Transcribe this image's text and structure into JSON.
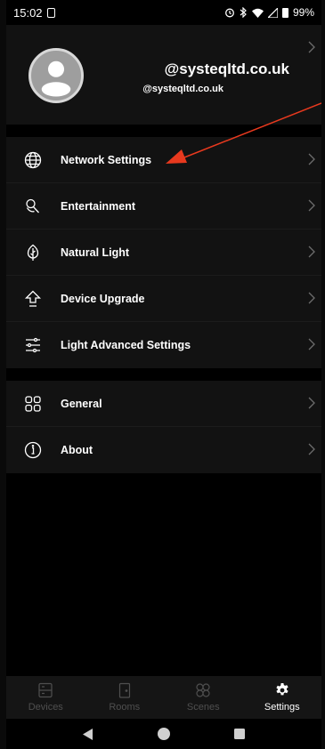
{
  "status": {
    "time": "15:02",
    "battery": "99%"
  },
  "profile": {
    "name": "@systeqltd.co.uk",
    "email": "@systeqltd.co.uk"
  },
  "menu_group_1": [
    {
      "label": "Network Settings",
      "icon": "globe-icon"
    },
    {
      "label": "Entertainment",
      "icon": "microphone-icon"
    },
    {
      "label": "Natural Light",
      "icon": "leaf-icon"
    },
    {
      "label": "Device Upgrade",
      "icon": "upgrade-arrow-icon"
    },
    {
      "label": "Light Advanced Settings",
      "icon": "sliders-icon"
    }
  ],
  "menu_group_2": [
    {
      "label": "General",
      "icon": "grid-icon"
    },
    {
      "label": "About",
      "icon": "info-icon"
    }
  ],
  "bottom_nav": [
    {
      "label": "Devices",
      "icon": "devices-icon",
      "active": false
    },
    {
      "label": "Rooms",
      "icon": "door-icon",
      "active": false
    },
    {
      "label": "Scenes",
      "icon": "scenes-icon",
      "active": false
    },
    {
      "label": "Settings",
      "icon": "gear-icon",
      "active": true
    }
  ],
  "colors": {
    "background": "#000000",
    "panel": "#121212",
    "annotation_arrow": "#e8391e",
    "inactive_nav": "#4f4f4f"
  }
}
